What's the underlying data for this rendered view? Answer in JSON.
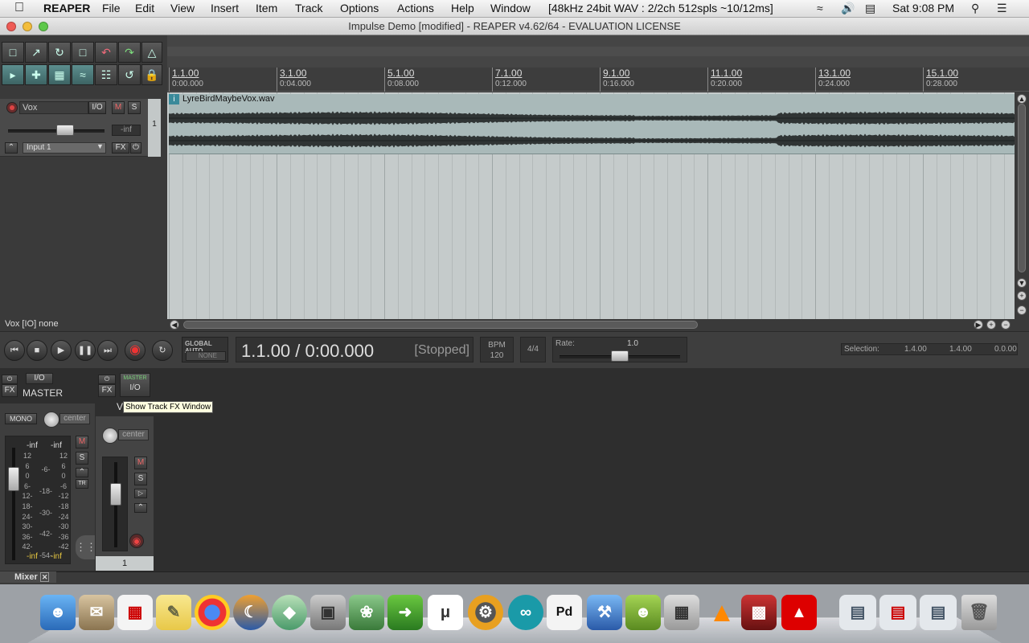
{
  "menubar": {
    "app": "REAPER",
    "items": [
      "File",
      "Edit",
      "View",
      "Insert",
      "Item",
      "Track",
      "Options",
      "Actions",
      "Help",
      "Window"
    ],
    "status": "[48kHz 24bit WAV : 2/2ch 512spls ~10/12ms]",
    "clock": "Sat 9:08 PM"
  },
  "window": {
    "title": "Impulse Demo [modified] - REAPER v4.62/64 - EVALUATION LICENSE"
  },
  "ruler": {
    "ticks": [
      {
        "bar": "1.1.00",
        "time": "0:00.000"
      },
      {
        "bar": "3.1.00",
        "time": "0:04.000"
      },
      {
        "bar": "5.1.00",
        "time": "0:08.000"
      },
      {
        "bar": "7.1.00",
        "time": "0:12.000"
      },
      {
        "bar": "9.1.00",
        "time": "0:16.000"
      },
      {
        "bar": "11.1.00",
        "time": "0:20.000"
      },
      {
        "bar": "13.1.00",
        "time": "0:24.000"
      },
      {
        "bar": "15.1.00",
        "time": "0:28.000"
      }
    ]
  },
  "track": {
    "name": "Vox",
    "io": "I/O",
    "mute": "M",
    "solo": "S",
    "volume": "-inf",
    "number": "1",
    "input": "Input 1",
    "fx": "FX",
    "item_name": "LyreBirdMaybeVox.wav"
  },
  "status_line": "Vox [IO] none",
  "transport": {
    "global_auto": "GLOBAL AUTO",
    "auto_mode": "NONE",
    "position": "1.1.00 / 0:00.000",
    "state": "[Stopped]",
    "bpm_label": "BPM",
    "bpm": "120",
    "time_sig": "4/4",
    "rate_label": "Rate:",
    "rate": "1.0",
    "selection_label": "Selection:",
    "sel_start": "1.4.00",
    "sel_end": "1.4.00",
    "sel_len": "0.0.00"
  },
  "mixer": {
    "master_label": "MASTER",
    "io": "I/O",
    "fx": "FX",
    "mono": "MONO",
    "pan": "center",
    "peak_l": "-inf",
    "peak_r": "-inf",
    "scale_left": [
      "12",
      "6",
      "0",
      "6-",
      "12-",
      "18-",
      "24-",
      "30-",
      "36-",
      "42-"
    ],
    "scale_mid": [
      "-6-",
      "-18-",
      "-30-",
      "-42-",
      "-54-"
    ],
    "scale_right": [
      "12",
      "6",
      "0",
      "-6",
      "-12",
      "-18",
      "-24",
      "-30",
      "-36",
      "-42"
    ],
    "m": "M",
    "s": "S",
    "tr": "TR",
    "track_pan": "center",
    "track_number": "1",
    "track_partial": "V",
    "tooltip": "Show Track FX Window",
    "tab": "Mixer"
  }
}
